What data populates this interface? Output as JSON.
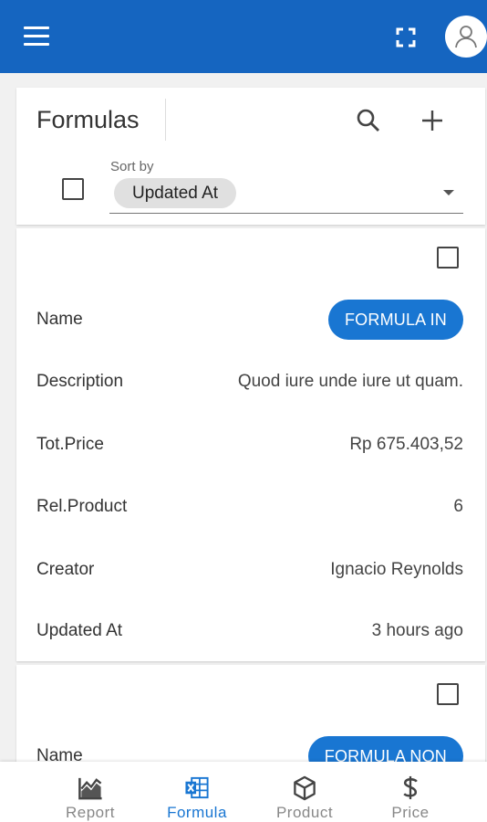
{
  "colors": {
    "primary": "#1565c0",
    "accent": "#1976d2",
    "background": "#f1f1f1"
  },
  "header": {
    "icons": [
      "menu-icon",
      "fullscreen-icon",
      "avatar-icon"
    ]
  },
  "list_header": {
    "title": "Formulas",
    "sort_label": "Sort by",
    "sort_value": "Updated At"
  },
  "records": [
    {
      "fields": [
        {
          "label": "Name",
          "value": "FORMULA IN"
        },
        {
          "label": "Description",
          "value": "Quod iure unde iure ut quam."
        },
        {
          "label": "Tot.Price",
          "value": "Rp 675.403,52"
        },
        {
          "label": "Rel.Product",
          "value": "6"
        },
        {
          "label": "Creator",
          "value": "Ignacio Reynolds"
        },
        {
          "label": "Updated At",
          "value": "3 hours ago"
        }
      ]
    },
    {
      "fields": [
        {
          "label": "Name",
          "value": "FORMULA NON"
        }
      ]
    }
  ],
  "bottom_nav": {
    "items": [
      {
        "label": "Report",
        "icon": "chart-icon"
      },
      {
        "label": "Formula",
        "icon": "excel-icon",
        "active": true
      },
      {
        "label": "Product",
        "icon": "box-icon"
      },
      {
        "label": "Price",
        "icon": "dollar-icon"
      }
    ]
  }
}
